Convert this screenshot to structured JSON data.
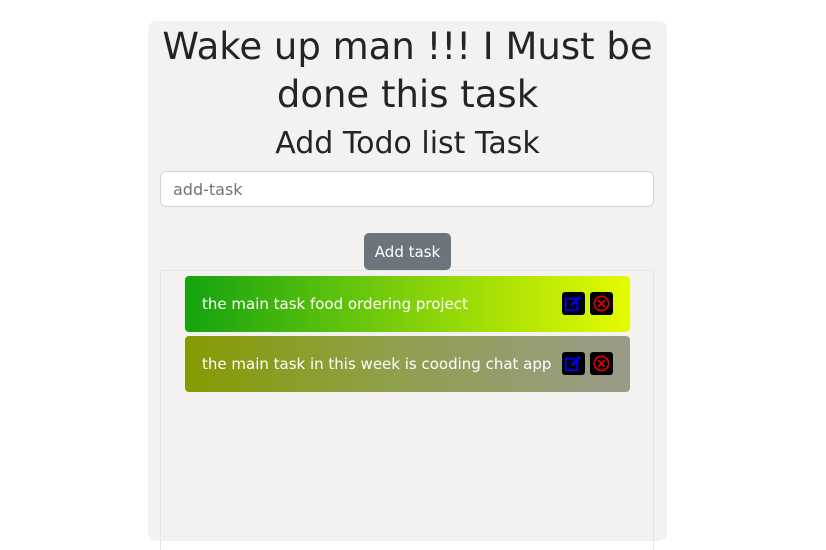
{
  "header": {
    "headline": "Wake up man !!! I Must be done this task",
    "subheading": "Add Todo list Task"
  },
  "form": {
    "input_value": "",
    "input_placeholder": "add-task",
    "add_button_label": "Add task"
  },
  "tasks": [
    {
      "text": "the main task food ordering project",
      "edit_icon": "edit-icon",
      "delete_icon": "delete-icon"
    },
    {
      "text": "the main task in this week is cooding chat app",
      "edit_icon": "edit-icon",
      "delete_icon": "delete-icon"
    }
  ],
  "colors": {
    "card_background": "#f3f2f1",
    "button_background": "#6c757d",
    "edit_icon_color": "#0000ee",
    "delete_icon_color": "#e00000"
  }
}
